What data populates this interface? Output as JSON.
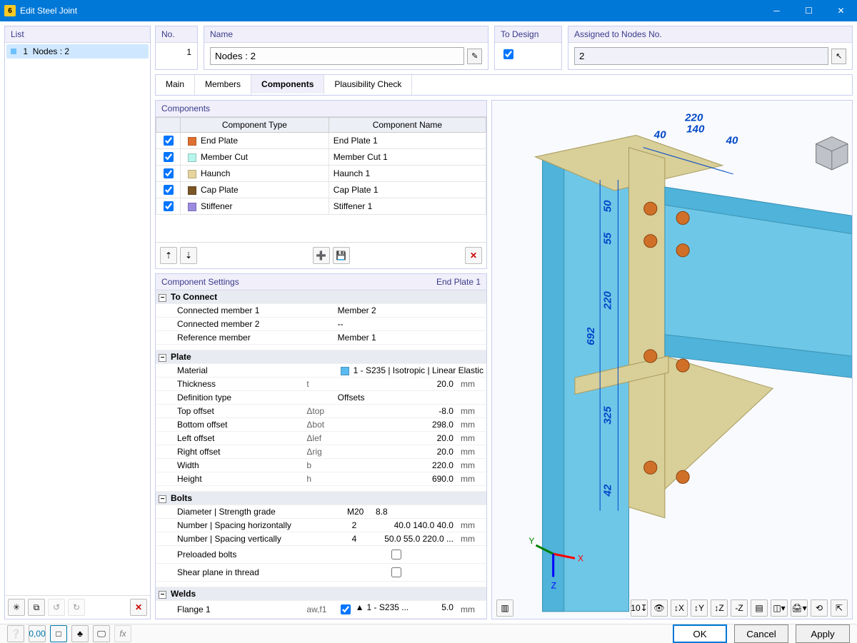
{
  "window": {
    "title": "Edit Steel Joint"
  },
  "sidebar": {
    "header": "List",
    "item_no": "1",
    "item_label": "Nodes : 2"
  },
  "header": {
    "no_label": "No.",
    "no_value": "1",
    "name_label": "Name",
    "name_value": "Nodes : 2",
    "todesign_label": "To Design",
    "assigned_label": "Assigned to Nodes No.",
    "assigned_value": "2"
  },
  "tabs": {
    "t0": "Main",
    "t1": "Members",
    "t2": "Components",
    "t3": "Plausibility Check"
  },
  "components": {
    "title": "Components",
    "col_type": "Component Type",
    "col_name": "Component Name",
    "rows": [
      {
        "type": "End Plate",
        "name": "End Plate 1",
        "color": "#e07030"
      },
      {
        "type": "Member Cut",
        "name": "Member Cut 1",
        "color": "#b6f5ec"
      },
      {
        "type": "Haunch",
        "name": "Haunch 1",
        "color": "#e5d49c"
      },
      {
        "type": "Cap Plate",
        "name": "Cap Plate 1",
        "color": "#7a5526"
      },
      {
        "type": "Stiffener",
        "name": "Stiffener 1",
        "color": "#9b8ae0"
      }
    ]
  },
  "settings": {
    "title": "Component Settings",
    "current": "End Plate 1",
    "g_connect": "To Connect",
    "cm1_l": "Connected member 1",
    "cm1_v": "Member 2",
    "cm2_l": "Connected member 2",
    "cm2_v": "--",
    "ref_l": "Reference member",
    "ref_v": "Member 1",
    "g_plate": "Plate",
    "mat_l": "Material",
    "mat_v": "1 - S235 | Isotropic | Linear Elastic",
    "thk_l": "Thickness",
    "thk_s": "t",
    "thk_v": "20.0",
    "thk_u": "mm",
    "def_l": "Definition type",
    "def_v": "Offsets",
    "top_l": "Top offset",
    "top_s": "Δtop",
    "top_v": "-8.0",
    "top_u": "mm",
    "bot_l": "Bottom offset",
    "bot_s": "Δbot",
    "bot_v": "298.0",
    "bot_u": "mm",
    "lef_l": "Left offset",
    "lef_s": "Δlef",
    "lef_v": "20.0",
    "lef_u": "mm",
    "rig_l": "Right offset",
    "rig_s": "Δrig",
    "rig_v": "20.0",
    "rig_u": "mm",
    "wid_l": "Width",
    "wid_s": "b",
    "wid_v": "220.0",
    "wid_u": "mm",
    "hei_l": "Height",
    "hei_s": "h",
    "hei_v": "690.0",
    "hei_u": "mm",
    "g_bolts": "Bolts",
    "dia_l": "Diameter | Strength grade",
    "dia_v1": "M20",
    "dia_v2": "8.8",
    "nh_l": "Number | Spacing horizontally",
    "nh_v1": "2",
    "nh_v2": "40.0 140.0 40.0",
    "nh_u": "mm",
    "nv_l": "Number | Spacing vertically",
    "nv_v1": "4",
    "nv_v2": "50.0 55.0 220.0 ...",
    "nv_u": "mm",
    "pre_l": "Preloaded bolts",
    "shr_l": "Shear plane in thread",
    "g_welds": "Welds",
    "fl1_l": "Flange 1",
    "fl1_s": "aw,f1",
    "fl1_m": "1 - S235 ...",
    "fl1_v": "5.0",
    "fl1_u": "mm"
  },
  "dims": {
    "d40a": "40",
    "d140": "140",
    "d40b": "40",
    "d220t": "220",
    "d50": "50",
    "d55": "55",
    "d220m": "220",
    "d692": "692",
    "d325": "325",
    "d42": "42"
  },
  "footer": {
    "ok": "OK",
    "cancel": "Cancel",
    "apply": "Apply"
  }
}
